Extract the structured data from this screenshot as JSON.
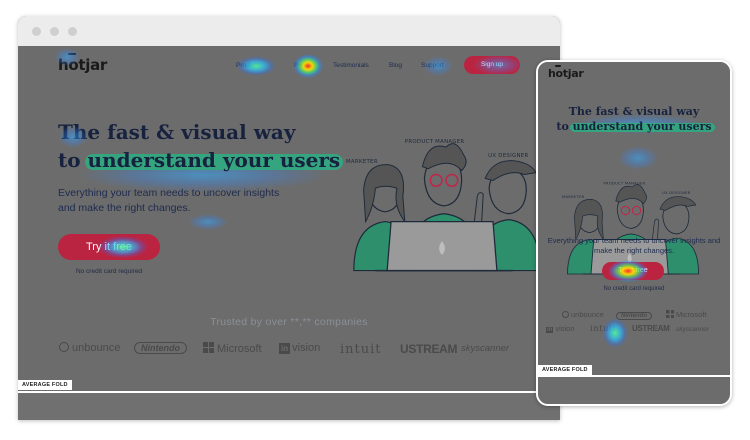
{
  "brand_name": "hotjar",
  "nav": {
    "items": [
      "Product",
      "Pricing",
      "Testimonials",
      "Blog",
      "Support"
    ],
    "signup_label": "Sign up"
  },
  "hero": {
    "title_line1": "The fast & visual way",
    "title_prefix": "to",
    "title_highlight": "understand your users",
    "subtitle": "Everything your team needs to uncover insights and make the right changes.",
    "cta_label": "Try it free",
    "no_credit_card": "No credit card required"
  },
  "illustration": {
    "tag_marketer": "MARKETER",
    "tag_product_manager": "PRODUCT MANAGER",
    "tag_ux_designer": "UX DESIGNER"
  },
  "trusted": {
    "label": "Trusted by over **,** companies",
    "logos": [
      "unbounce",
      "Nintendo",
      "Microsoft",
      "vision",
      "intuit",
      "USTREAM",
      "skyscanner"
    ],
    "logo_prefix_vision": "in"
  },
  "fold_label": "AVERAGE FOLD",
  "colors": {
    "overlay": "#6c6c6c",
    "brand_red": "#bb2440",
    "highlight_green": "#35a57f",
    "navy_text": "#17223f"
  }
}
